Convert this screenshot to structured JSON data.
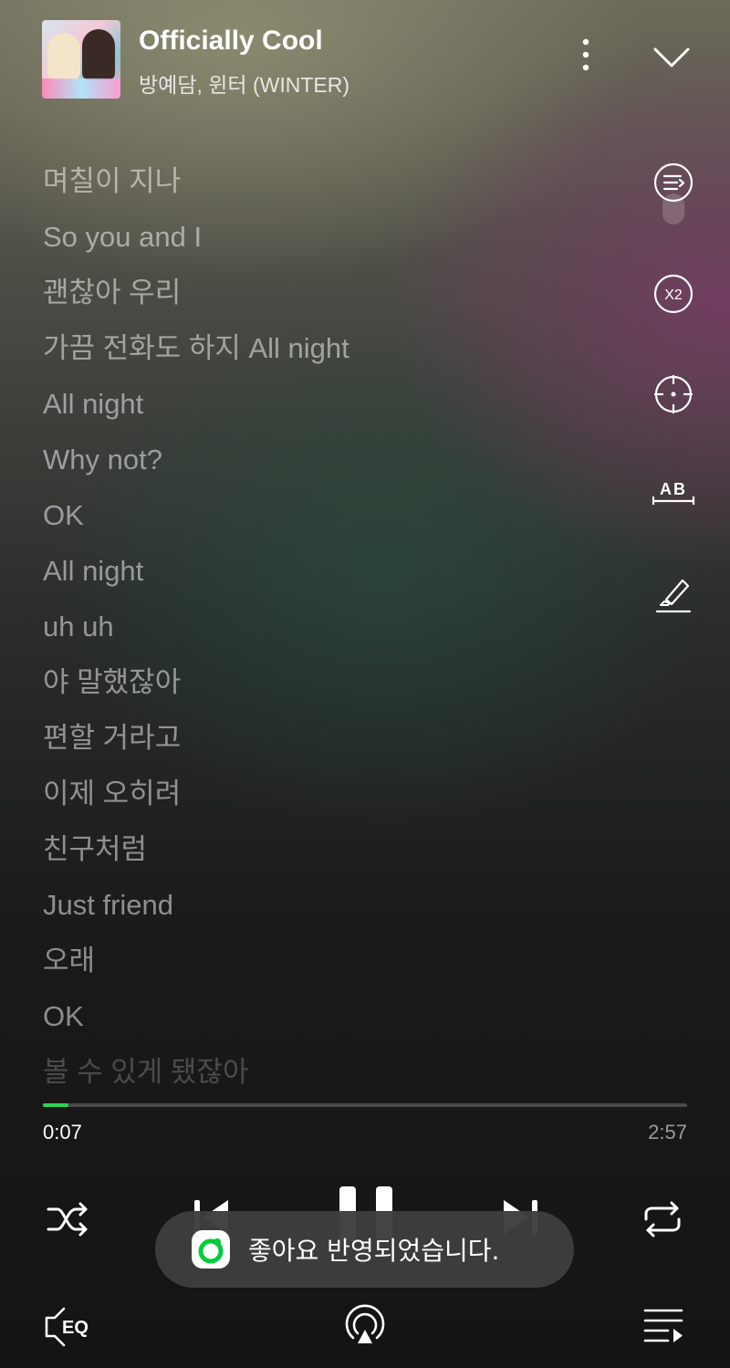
{
  "header": {
    "title": "Officially Cool",
    "artist": "방예담, 윈터 (WINTER)",
    "album_art_icon": "album-cover",
    "more_icon": "more-vertical-icon",
    "collapse_icon": "chevron-down-icon"
  },
  "lyrics": [
    "며칠이 지나",
    "So you and I",
    "괜찮아 우리",
    "가끔 전화도 하지 All night",
    "All night",
    "Why not?",
    "OK",
    "All night",
    "uh uh",
    "야 말했잖아",
    "편할 거라고",
    "이제 오히려",
    "친구처럼",
    "Just friend",
    "오래",
    "OK",
    "볼 수 있게 됐잖아"
  ],
  "tools": {
    "lyrics_mode_icon": "lyrics-list-icon",
    "speed_label": "X2",
    "focus_icon": "crosshair-icon",
    "translate_label": "AB",
    "highlight_icon": "highlighter-icon"
  },
  "playback": {
    "current_time": "0:07",
    "total_time": "2:57",
    "progress_fraction": 0.04,
    "accent_color": "#2ed35a"
  },
  "controls": {
    "shuffle_icon": "shuffle-icon",
    "previous_icon": "previous-icon",
    "pause_icon": "pause-icon",
    "next_icon": "next-icon",
    "repeat_icon": "repeat-icon"
  },
  "toast": {
    "message": "좋아요 반영되었습니다.",
    "icon": "melon-icon"
  },
  "bottom": {
    "eq_label": "EQ",
    "cast_icon": "cast-icon",
    "queue_icon": "playlist-icon"
  }
}
